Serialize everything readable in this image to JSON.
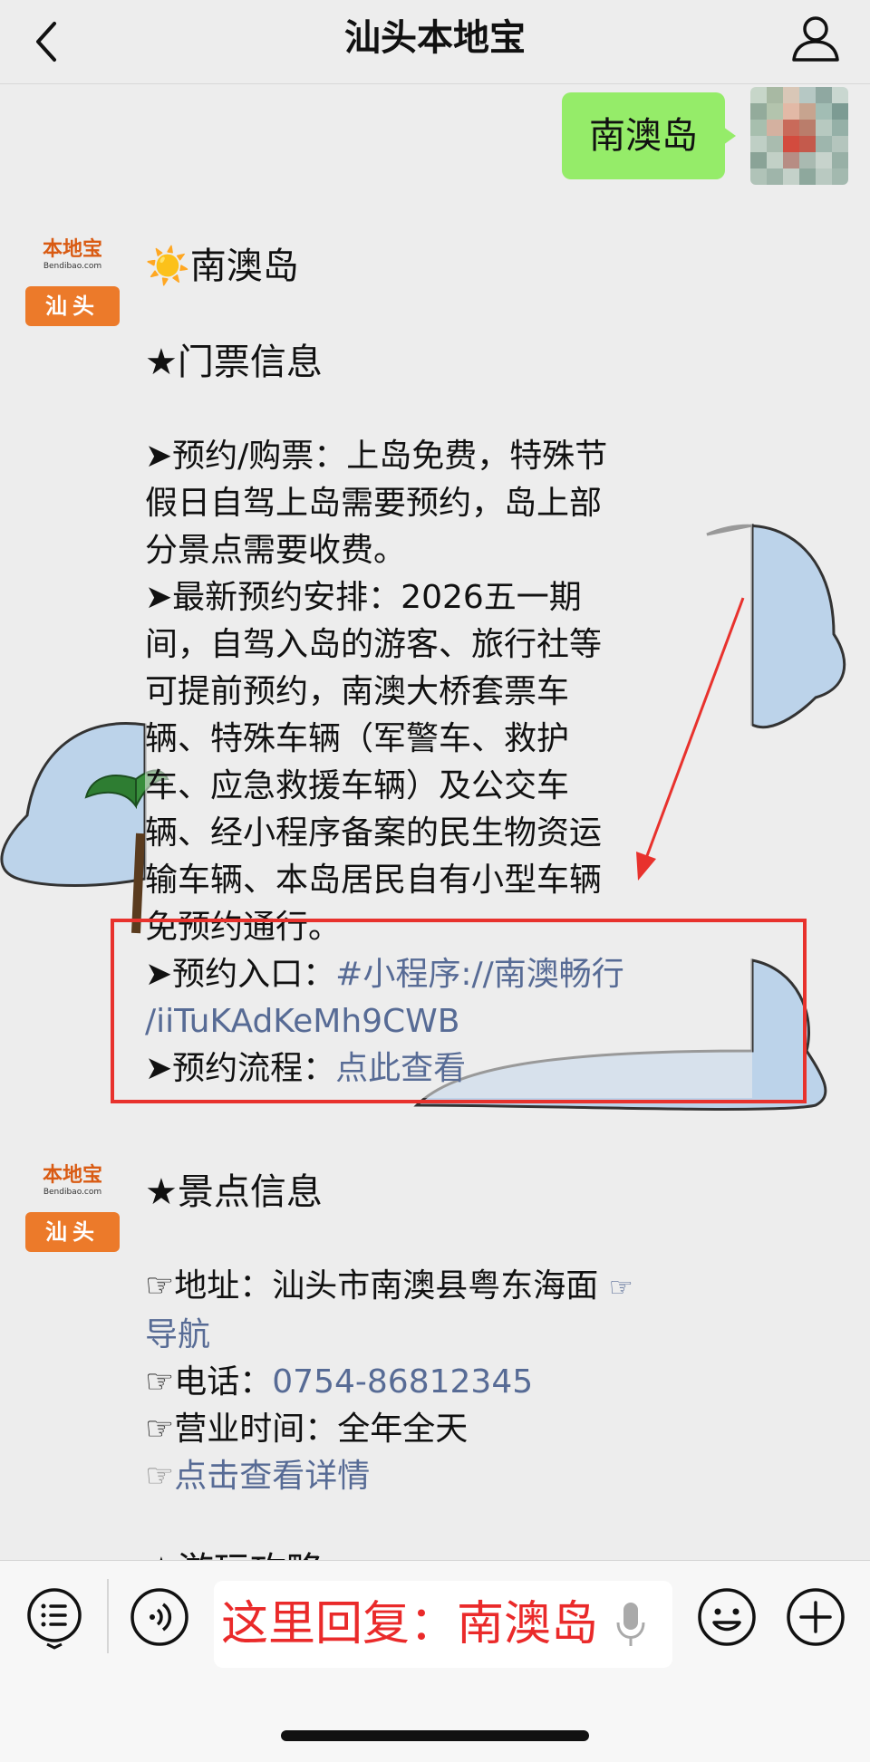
{
  "header": {
    "title": "汕头本地宝"
  },
  "outgoing_message": {
    "text": "南澳岛"
  },
  "account": {
    "brand": "本地宝",
    "site": "Bendibao.com",
    "city": "汕头"
  },
  "message1": {
    "heading": "☀️南澳岛",
    "section_title": "★门票信息",
    "lines": [
      "➤预约/购票：上岛免费，特殊节",
      "假日自驾上岛需要预约，岛上部",
      "分景点需要收费。",
      "➤最新预约安排：2026五一期",
      "间，自驾入岛的游客、旅行社等",
      "可提前预约，南澳大桥套票车",
      "辆、特殊车辆（军警车、救护",
      "车、应急救援车辆）及公交车",
      "辆、经小程序备案的民生物资运",
      "输车辆、本岛居民自有小型车辆",
      "免预约通行。"
    ],
    "entry_label": "➤预约入口：",
    "entry_link_line1": "#小程序://南澳畅行",
    "entry_link_line2": "/iiTuKAdKeMh9CWB",
    "process_label": "➤预约流程：",
    "process_link": "点此查看"
  },
  "message2": {
    "section_title": "★景点信息",
    "address_label": "☞地址：汕头市南澳县粤东海面",
    "address_link_icon": "☞",
    "address_link": "导航",
    "phone_label": "☞电话：",
    "phone_value": "0754-86812345",
    "hours": "☞营业时间：全年全天",
    "details_icon": "☞",
    "details_link": "点击查看详情",
    "next_section_partial": "★游玩攻略"
  },
  "input_bar": {
    "hint": "这里回复：南澳岛"
  },
  "colors": {
    "wechat_green": "#95ec69",
    "link_blue": "#576b95",
    "highlight_red": "#e8322d",
    "brand_orange": "#ec7a2a"
  },
  "icons": [
    "back-arrow-icon",
    "profile-icon",
    "menu-list-icon",
    "voice-icon",
    "mic-icon",
    "emoji-icon",
    "plus-icon"
  ]
}
